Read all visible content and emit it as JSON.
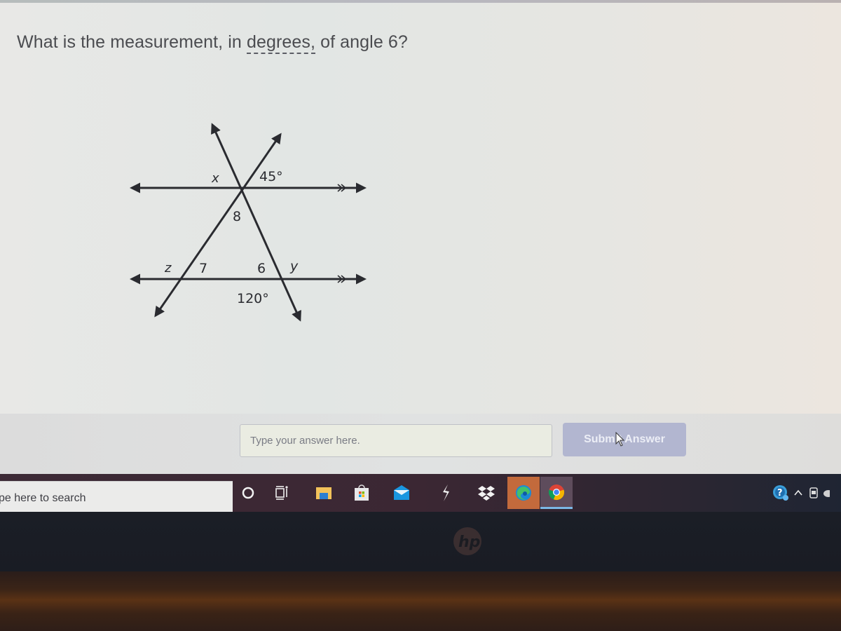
{
  "question": {
    "prefix": "What is the measurement, in ",
    "glossary_term": "degrees,",
    "suffix": " of angle 6?"
  },
  "diagram": {
    "description": "Two parallel horizontal lines cut by two intersecting transversals",
    "labels": {
      "x": "x",
      "given_top": "45°",
      "angle_8": "8",
      "z": "z",
      "angle_7": "7",
      "angle_6": "6",
      "y": "y",
      "given_bottom": "120°"
    },
    "parallel_marker": "double-chevron"
  },
  "answer": {
    "placeholder": "Type your answer here.",
    "value": "",
    "submit_label": "Submit Answer"
  },
  "taskbar": {
    "search_placeholder": "pe here to search",
    "icons": [
      {
        "name": "cortana-icon"
      },
      {
        "name": "task-view-icon"
      },
      {
        "name": "file-explorer-icon"
      },
      {
        "name": "microsoft-store-icon"
      },
      {
        "name": "mail-icon"
      },
      {
        "name": "app-bolt-icon"
      },
      {
        "name": "dropbox-icon"
      },
      {
        "name": "edge-icon"
      },
      {
        "name": "chrome-icon"
      }
    ],
    "tray": [
      "help-icon",
      "chevron-up-icon",
      "meet-icon"
    ]
  },
  "device": {
    "brand": "hp"
  },
  "colors": {
    "submit_bg": "#b2b6d0",
    "taskbar_bg": "#3b2733",
    "edge_highlight": "#c36a3c",
    "chrome_active": "#7bb7e6"
  }
}
